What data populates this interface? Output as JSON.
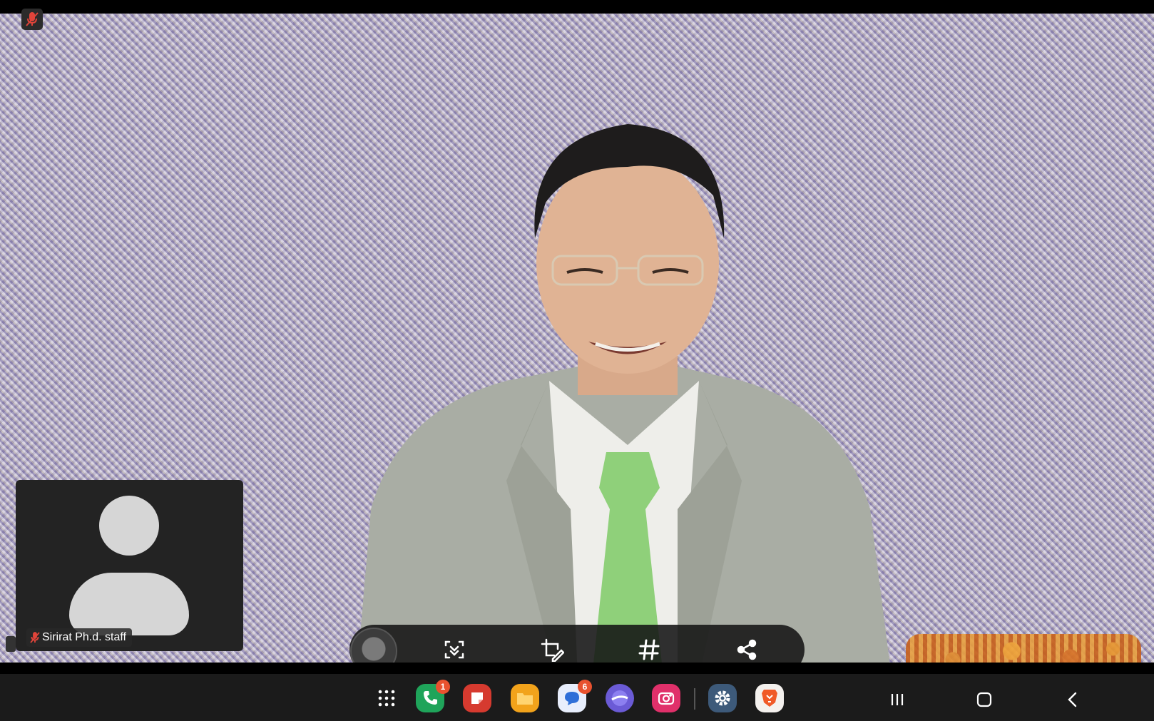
{
  "call": {
    "self_name": "Sirirat Ph.d. staff",
    "self_muted": true
  },
  "toolbar": {
    "tools": [
      {
        "icon": "scan-capture-icon"
      },
      {
        "icon": "crop-draw-icon"
      },
      {
        "icon": "hashtag-icon"
      },
      {
        "icon": "share-icon"
      }
    ]
  },
  "taskbar": {
    "apps": [
      {
        "icon": "app-drawer-icon"
      },
      {
        "icon": "phone-icon",
        "color": "#1fa45a",
        "badge": "1"
      },
      {
        "icon": "notes-icon",
        "color": "#d63a2f"
      },
      {
        "icon": "files-icon",
        "color": "#f2a31b"
      },
      {
        "icon": "messages-icon",
        "color": "#e8eefc",
        "badge": "6"
      },
      {
        "icon": "internet-icon",
        "color": "#6b5bd6"
      },
      {
        "icon": "camera-icon",
        "color": "#e0306a"
      },
      {
        "icon": "settings-icon",
        "color": "#3d5a7a"
      },
      {
        "icon": "brave-icon",
        "color": "#f05a28"
      }
    ]
  }
}
